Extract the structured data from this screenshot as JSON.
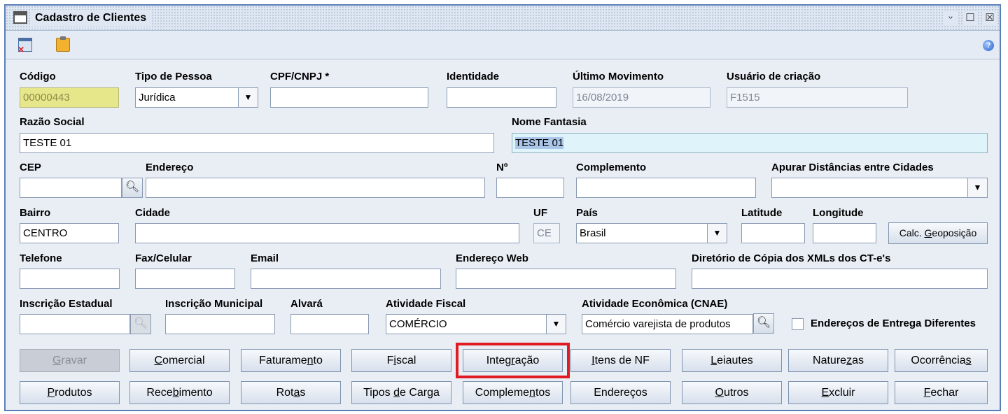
{
  "window": {
    "title": "Cadastro de Clientes",
    "buttons": [
      "ᵕ",
      "☐",
      "☒"
    ]
  },
  "labels": {
    "codigo": "Código",
    "tipo_pessoa": "Tipo de Pessoa",
    "cpf_cnpj": "CPF/CNPJ *",
    "identidade": "Identidade",
    "ultimo_movimento": "Último Movimento",
    "usuario_criacao": "Usuário de criação",
    "razao_social": "Razão Social",
    "nome_fantasia": "Nome Fantasia",
    "cep": "CEP",
    "endereco": "Endereço",
    "numero": "Nº",
    "complemento": "Complemento",
    "apurar": "Apurar Distâncias entre Cidades",
    "bairro": "Bairro",
    "cidade": "Cidade",
    "uf": "UF",
    "pais": "País",
    "latitude": "Latitude",
    "longitude": "Longitude",
    "telefone": "Telefone",
    "fax": "Fax/Celular",
    "email": "Email",
    "endereco_web": "Endereço Web",
    "diretorio_xml": "Diretório de Cópia dos XMLs dos CT-e's",
    "insc_estadual": "Inscrição Estadual",
    "insc_municipal": "Inscrição Municipal",
    "alvara": "Alvará",
    "atividade_fiscal": "Atividade Fiscal",
    "atividade_economica": "Atividade Econômica (CNAE)",
    "enderecos_entrega": "Endereços de Entrega Diferentes"
  },
  "values": {
    "codigo": "00000443",
    "tipo_pessoa": "Jurídica",
    "cpf_cnpj": "",
    "identidade": "",
    "ultimo_movimento": "16/08/2019",
    "usuario_criacao": "F1515",
    "razao_social": "TESTE 01",
    "nome_fantasia": "TESTE 01",
    "cep": "",
    "endereco": "",
    "numero": "",
    "complemento": "",
    "apurar": "",
    "bairro": "CENTRO",
    "cidade": "",
    "uf": "CE",
    "pais": "Brasil",
    "latitude": "",
    "longitude": "",
    "telefone": "",
    "fax": "",
    "email": "",
    "endereco_web": "",
    "diretorio_xml": "",
    "insc_estadual": "",
    "insc_municipal": "",
    "alvara": "",
    "atividade_fiscal": "COMÉRCIO",
    "atividade_economica": "Comércio varejista de produtos",
    "enderecos_entrega": false
  },
  "geo_button": {
    "pre": "Calc. ",
    "u": "G",
    "post": "eoposição"
  },
  "buttons_row1": [
    {
      "pre": "",
      "u": "G",
      "post": "ravar"
    },
    {
      "pre": "",
      "u": "C",
      "post": "omercial"
    },
    {
      "pre": "Faturame",
      "u": "n",
      "post": "to"
    },
    {
      "pre": "F",
      "u": "i",
      "post": "scal"
    },
    {
      "pre": "Integ",
      "u": "r",
      "post": "ação"
    },
    {
      "pre": "",
      "u": "I",
      "post": "tens de NF"
    },
    {
      "pre": "",
      "u": "L",
      "post": "eiautes"
    },
    {
      "pre": "Nature",
      "u": "z",
      "post": "as"
    },
    {
      "pre": "Ocorrência",
      "u": "s",
      "post": ""
    }
  ],
  "buttons_row2": [
    {
      "pre": "",
      "u": "P",
      "post": "rodutos"
    },
    {
      "pre": "Rece",
      "u": "b",
      "post": "imento"
    },
    {
      "pre": "Rot",
      "u": "a",
      "post": "s"
    },
    {
      "pre": "Tipos ",
      "u": "d",
      "post": "e Carga"
    },
    {
      "pre": "Compleme",
      "u": "n",
      "post": "tos"
    },
    {
      "pre": "Endereços",
      "u": "",
      "post": ""
    },
    {
      "pre": "",
      "u": "O",
      "post": "utros"
    },
    {
      "pre": "",
      "u": "E",
      "post": "xcluir"
    },
    {
      "pre": "",
      "u": "F",
      "post": "echar"
    }
  ]
}
